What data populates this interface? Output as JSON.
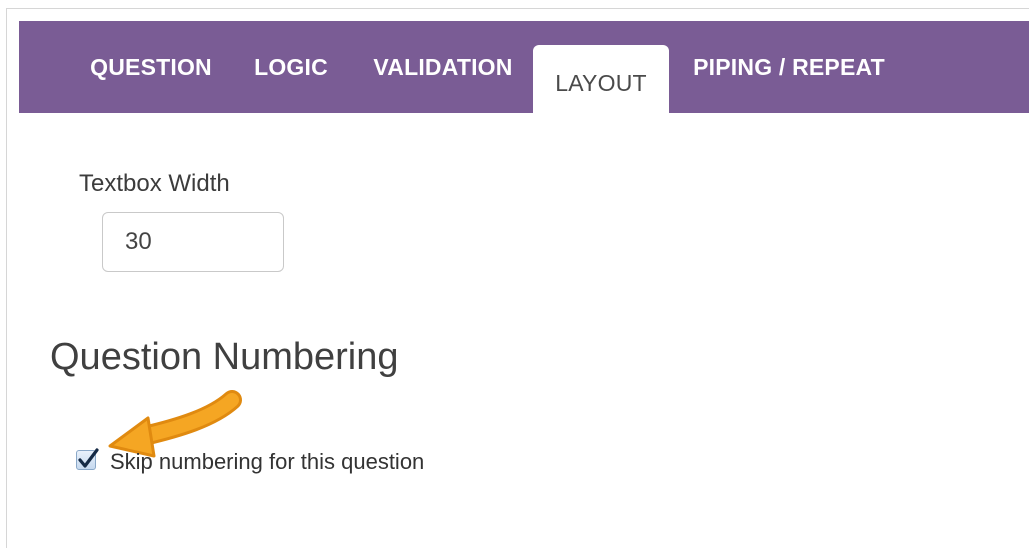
{
  "tabs": [
    {
      "label": "QUESTION",
      "active": false
    },
    {
      "label": "LOGIC",
      "active": false
    },
    {
      "label": "VALIDATION",
      "active": false
    },
    {
      "label": "LAYOUT",
      "active": true
    },
    {
      "label": "PIPING / REPEAT",
      "active": false
    }
  ],
  "layout": {
    "textbox_width_label": "Textbox Width",
    "textbox_width_value": "30"
  },
  "numbering": {
    "section_title": "Question Numbering",
    "skip_label": "Skip numbering for this question",
    "skip_checked": true
  },
  "colors": {
    "tabbar": "#7a5c95",
    "annotation_arrow": "#f5a623"
  },
  "icons": {
    "annotation": "arrow-pointer-icon",
    "checkmark": "checkmark-icon"
  }
}
